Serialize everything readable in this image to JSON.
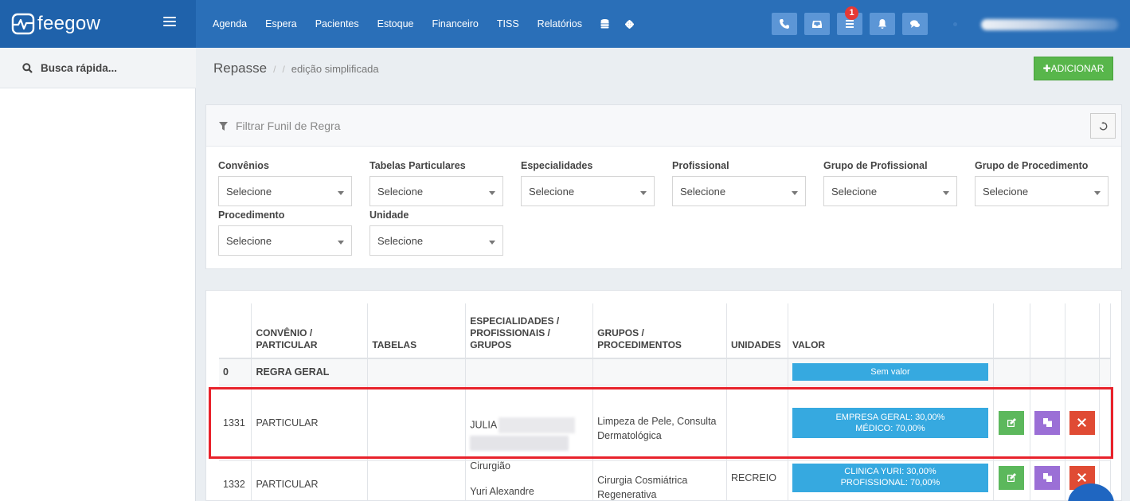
{
  "brand": {
    "name": "feegow",
    "logo_icon": "heart-pulse-icon",
    "menu_icon": "hamburger-icon"
  },
  "nav": {
    "items": [
      "Agenda",
      "Espera",
      "Pacientes",
      "Estoque",
      "Financeiro",
      "TISS",
      "Relatórios"
    ],
    "extra_icons": [
      "database-icon",
      "gear-icon"
    ]
  },
  "toolbar": {
    "buttons": [
      {
        "icon": "phone-icon"
      },
      {
        "icon": "inbox-icon"
      },
      {
        "icon": "list-icon",
        "badge": "1"
      },
      {
        "icon": "bell-icon"
      },
      {
        "icon": "chat-icon"
      }
    ]
  },
  "sidebar": {
    "search_label": "Busca rápida..."
  },
  "header": {
    "title": "Repasse",
    "sep1": "/",
    "sep2": "/",
    "subtitle": "edição simplificada",
    "add_label": "✚ADICIONAR"
  },
  "filter": {
    "title": "Filtrar Funil de Regra",
    "fields": [
      {
        "label": "Convênios",
        "value": "Selecione"
      },
      {
        "label": "Tabelas Particulares",
        "value": "Selecione"
      },
      {
        "label": "Especialidades",
        "value": "Selecione"
      },
      {
        "label": "Profissional",
        "value": "Selecione"
      },
      {
        "label": "Grupo de Profissional",
        "value": "Selecione"
      },
      {
        "label": "Grupo de Procedimento",
        "value": "Selecione"
      },
      {
        "label": "Procedimento",
        "value": "Selecione"
      },
      {
        "label": "Unidade",
        "value": "Selecione"
      }
    ]
  },
  "table": {
    "headers": {
      "convenio": "CONVÊNIO / PARTICULAR",
      "tabelas": "TABELAS",
      "especialidades": "ESPECIALIDADES / PROFISSIONAIS / GRUPOS",
      "grupos": "GRUPOS / PROCEDIMENTOS",
      "unidades": "UNIDADES",
      "valor": "VALOR"
    },
    "rows": [
      {
        "id": "0",
        "convenio": "REGRA GERAL",
        "valor1": "Sem valor"
      },
      {
        "id": "1331",
        "convenio": "PARTICULAR",
        "prof": "JULIA",
        "proc": "Limpeza de Pele, Consulta Dermatológica",
        "valor1": "EMPRESA GERAL: 30,00%",
        "valor2": "MÉDICO: 70,00%"
      },
      {
        "id": "1332",
        "convenio": "PARTICULAR",
        "prof_top": "Cirurgião",
        "prof": "Yuri Alexandre",
        "proc": "Cirurgia Cosmiátrica Regenerativa",
        "unidade": "RECREIO",
        "valor1": "CLINICA YURI: 30,00%",
        "valor2": "PROFISSIONAL: 70,00%"
      }
    ],
    "action_icons": [
      "edit-icon",
      "copy-icon",
      "delete-icon"
    ]
  },
  "colors": {
    "navbar": "#2a6fb8",
    "brand_bg": "#1f62ab",
    "add_button": "#58b64b",
    "value_button": "#36a9e0",
    "edit": "#5cb85c",
    "copy": "#9b6fd6",
    "delete": "#e04b34",
    "highlight": "#e8222b"
  }
}
